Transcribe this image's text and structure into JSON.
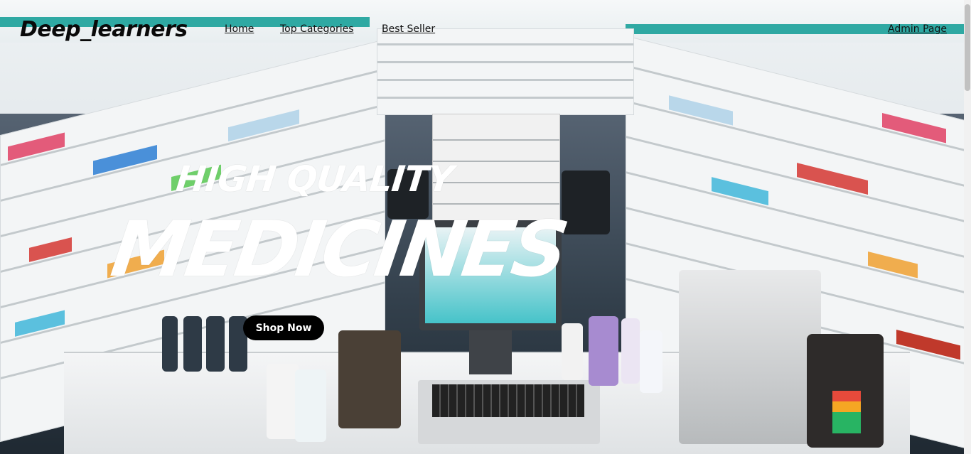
{
  "navbar": {
    "logo": "Deep_learners",
    "links": [
      {
        "label": "Home"
      },
      {
        "label": "Top Categories"
      },
      {
        "label": "Best Seller"
      }
    ],
    "admin_link": "Admin Page"
  },
  "hero": {
    "line1": "High Quality",
    "line2": "Medicines",
    "cta_label": "Shop Now",
    "background_image": "pharmacy-interior"
  },
  "colors": {
    "button_bg": "#000000",
    "button_text": "#ffffff",
    "hero_text": "#ffffff",
    "nav_text": "#111111"
  }
}
